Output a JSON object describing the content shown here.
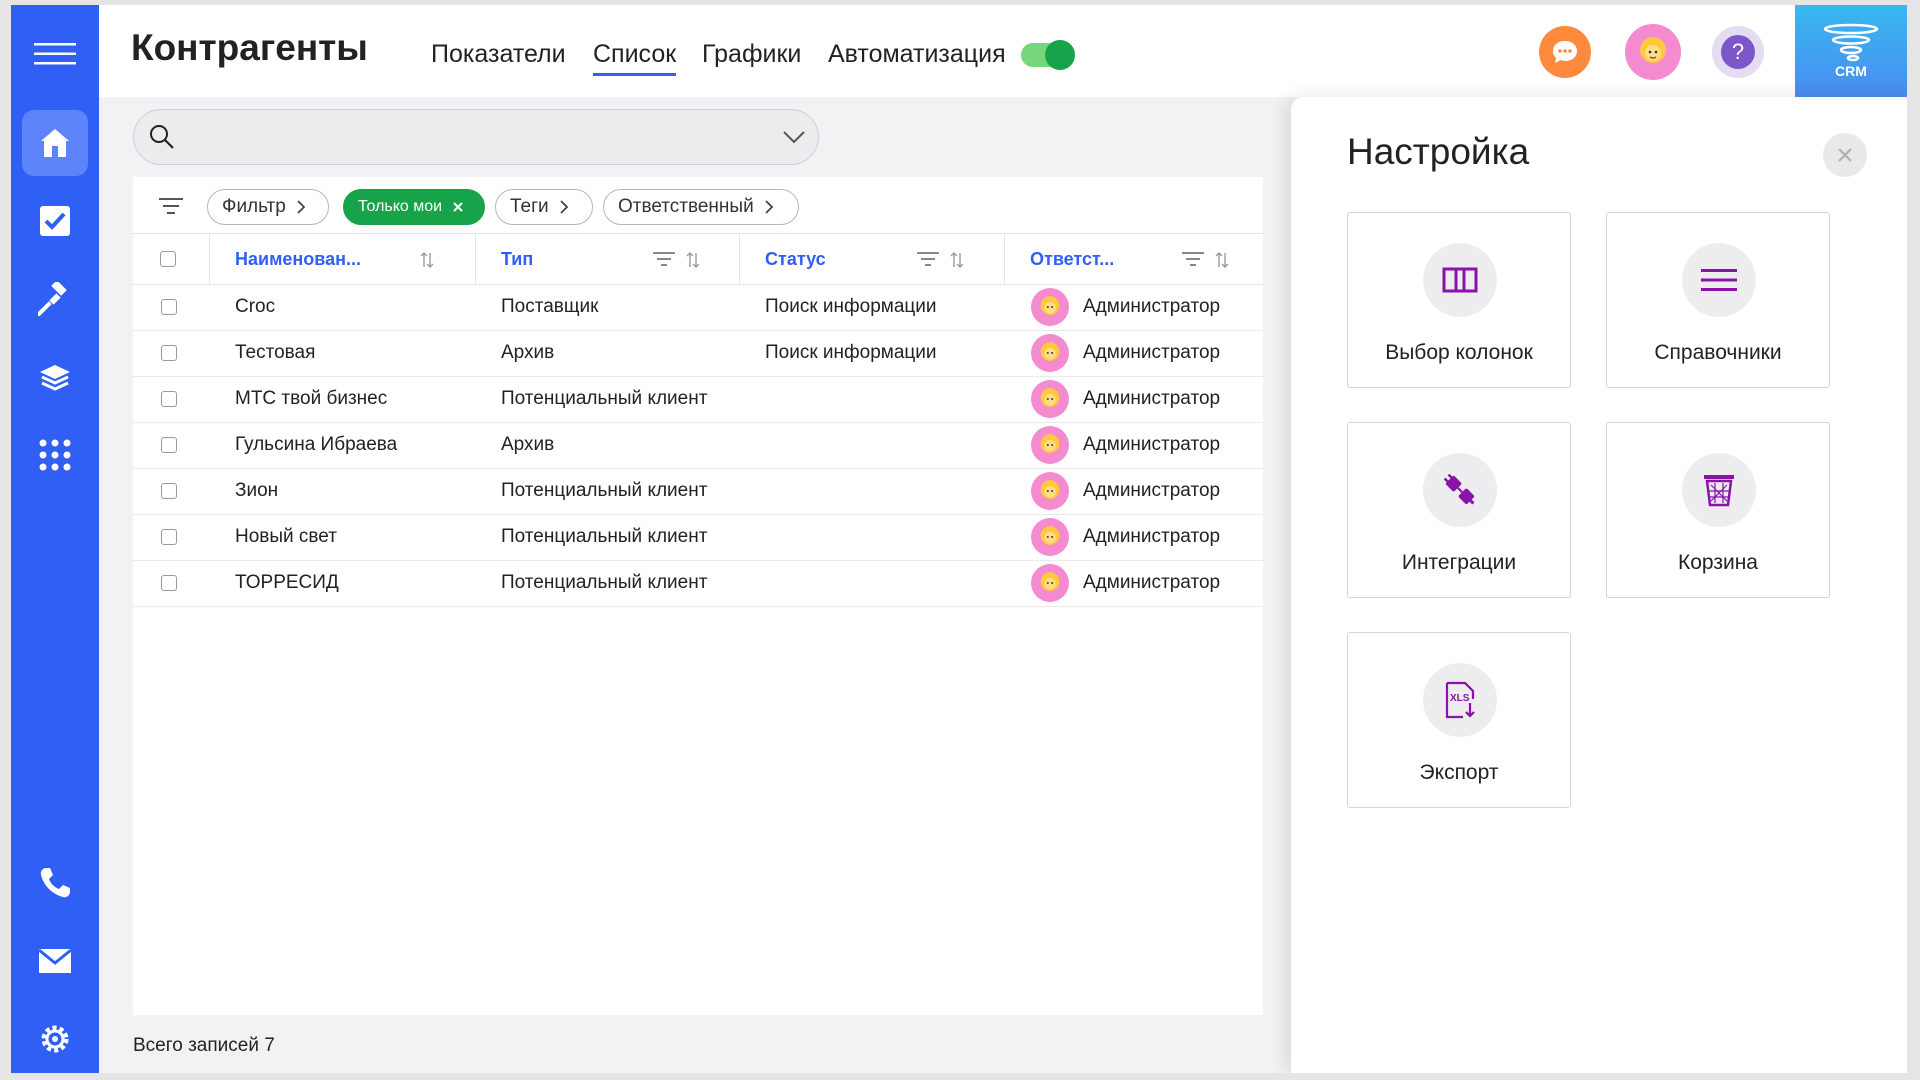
{
  "header": {
    "title": "Контрагенты",
    "tabs": [
      {
        "label": "Показатели"
      },
      {
        "label": "Список"
      },
      {
        "label": "Графики"
      },
      {
        "label": "Автоматизация"
      }
    ],
    "active_tab": "Список",
    "toggle_on": true,
    "crm_label": "CRM"
  },
  "sidebar": {
    "items": [
      {
        "icon": "menu-icon"
      },
      {
        "icon": "home-icon",
        "active": true
      },
      {
        "icon": "tasks-check-icon"
      },
      {
        "icon": "hammer-icon"
      },
      {
        "icon": "layers-icon"
      },
      {
        "icon": "apps-grid-icon"
      },
      {
        "icon": "phone-icon"
      },
      {
        "icon": "mail-icon"
      },
      {
        "icon": "settings-gear-icon"
      }
    ]
  },
  "search": {
    "placeholder": ""
  },
  "filters": {
    "chips": [
      {
        "label": "Фильтр"
      },
      {
        "label": "Только мои"
      },
      {
        "label": "Теги"
      },
      {
        "label": "Ответственный"
      }
    ]
  },
  "table": {
    "columns": [
      {
        "label": "Наименован..."
      },
      {
        "label": "Тип"
      },
      {
        "label": "Статус"
      },
      {
        "label": "Ответст..."
      }
    ],
    "rows": [
      {
        "name": "Croc",
        "type": "Поставщик",
        "status": "Поиск информации",
        "owner": "Администратор"
      },
      {
        "name": "Тестовая",
        "type": "Архив",
        "status": "Поиск информации",
        "owner": "Администратор"
      },
      {
        "name": "МТС твой бизнес",
        "type": "Потенциальный клиент",
        "status": "",
        "owner": "Администратор"
      },
      {
        "name": "Гульсина Ибраева",
        "type": "Архив",
        "status": "",
        "owner": "Администратор"
      },
      {
        "name": "Зион",
        "type": "Потенциальный клиент",
        "status": "",
        "owner": "Администратор"
      },
      {
        "name": "Новый свет",
        "type": "Потенциальный клиент",
        "status": "",
        "owner": "Администратор"
      },
      {
        "name": "ТОРРЕСИД",
        "type": "Потенциальный клиент",
        "status": "",
        "owner": "Администратор"
      }
    ]
  },
  "footer": {
    "total": "Всего записей 7"
  },
  "settings": {
    "title": "Настройка",
    "cards": [
      {
        "label": "Выбор колонок",
        "icon": "columns-icon"
      },
      {
        "label": "Справочники",
        "icon": "list-lines-icon"
      },
      {
        "label": "Интеграции",
        "icon": "plug-icon"
      },
      {
        "label": "Корзина",
        "icon": "trash-icon"
      },
      {
        "label": "Экспорт",
        "icon": "xls-export-icon"
      }
    ]
  },
  "colors": {
    "primary": "#2f5ff5",
    "accent_green": "#16a34a",
    "card_icon": "#8a12a8",
    "chat_orange": "#ff8a3d",
    "help_purple": "#7b57c8"
  }
}
